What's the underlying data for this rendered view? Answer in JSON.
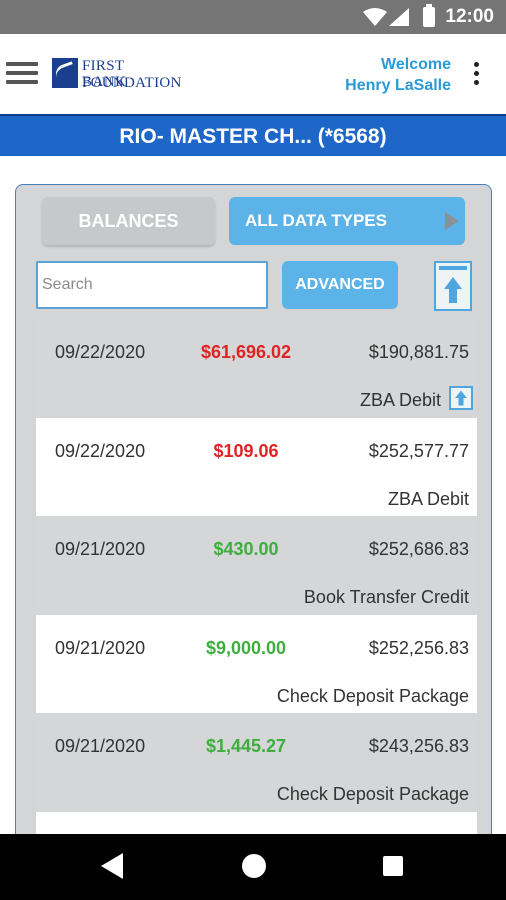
{
  "status_bar": {
    "time": "12:00"
  },
  "header": {
    "logo_line1": "FIRST FOUNDATION",
    "logo_line2": "BANK",
    "welcome_label": "Welcome",
    "user_name": "Henry LaSalle"
  },
  "account": {
    "title": "RIO- MASTER CH...  (*6568)"
  },
  "controls": {
    "balances_label": "BALANCES",
    "data_types_label": "ALL DATA TYPES",
    "search_placeholder": "Search",
    "advanced_label": "ADVANCED"
  },
  "transactions": [
    {
      "date": "09/22/2020",
      "amount": "$61,696.02",
      "balance": "$190,881.75",
      "description": "ZBA Debit"
    },
    {
      "date": "09/22/2020",
      "amount": "$109.06",
      "balance": "$252,577.77",
      "description": "ZBA Debit"
    },
    {
      "date": "09/21/2020",
      "amount": "$430.00",
      "balance": "$252,686.83",
      "description": "Book Transfer Credit"
    },
    {
      "date": "09/21/2020",
      "amount": "$9,000.00",
      "balance": "$252,256.83",
      "description": "Check Deposit Package"
    },
    {
      "date": "09/21/2020",
      "amount": "$1,445.27",
      "balance": "$243,256.83",
      "description": "Check Deposit Package"
    }
  ],
  "colors": {
    "debit": "#e02424",
    "credit": "#3fae3f",
    "accent": "#1e66c8"
  }
}
